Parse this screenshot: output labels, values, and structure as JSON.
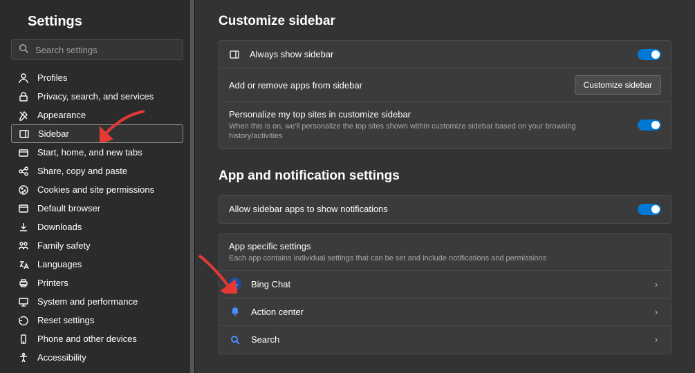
{
  "header": {
    "title": "Settings"
  },
  "search": {
    "placeholder": "Search settings"
  },
  "nav": {
    "items": [
      {
        "label": "Profiles"
      },
      {
        "label": "Privacy, search, and services"
      },
      {
        "label": "Appearance"
      },
      {
        "label": "Sidebar"
      },
      {
        "label": "Start, home, and new tabs"
      },
      {
        "label": "Share, copy and paste"
      },
      {
        "label": "Cookies and site permissions"
      },
      {
        "label": "Default browser"
      },
      {
        "label": "Downloads"
      },
      {
        "label": "Family safety"
      },
      {
        "label": "Languages"
      },
      {
        "label": "Printers"
      },
      {
        "label": "System and performance"
      },
      {
        "label": "Reset settings"
      },
      {
        "label": "Phone and other devices"
      },
      {
        "label": "Accessibility"
      }
    ]
  },
  "sections": {
    "customize": {
      "title": "Customize sidebar",
      "always_show": "Always show sidebar",
      "addremove": "Add or remove apps from sidebar",
      "customize_btn": "Customize sidebar",
      "personalize": "Personalize my top sites in customize sidebar",
      "personalize_sub": "When this is on, we'll personalize the top sites shown within customize sidebar based on your browsing history/activities"
    },
    "appnotif": {
      "title": "App and notification settings",
      "allow": "Allow sidebar apps to show notifications",
      "appspecific": "App specific settings",
      "appspecific_sub": "Each app contains individual settings that can be set and include notifications and permissions",
      "apps": [
        {
          "label": "Bing Chat"
        },
        {
          "label": "Action center"
        },
        {
          "label": "Search"
        }
      ]
    }
  }
}
